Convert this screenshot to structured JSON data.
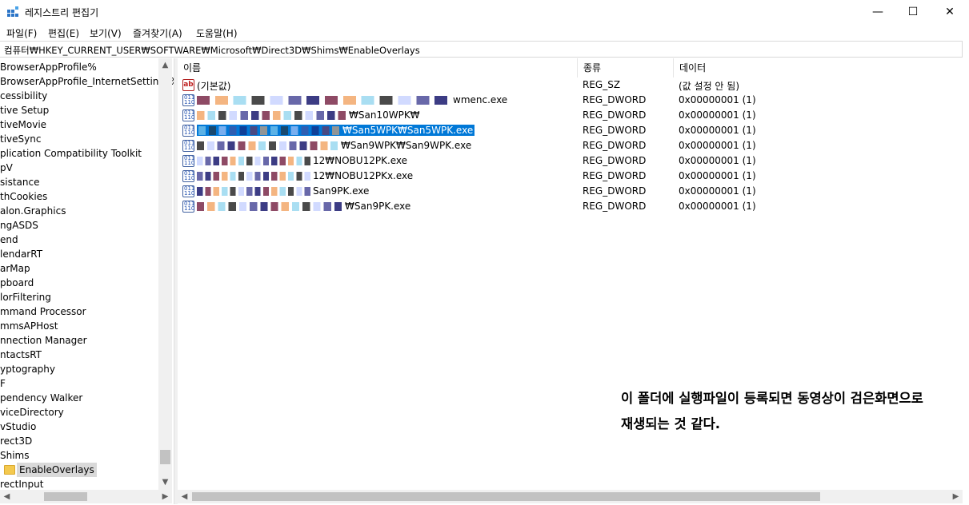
{
  "window": {
    "title": "레지스트리 편집기",
    "minimize_glyph": "—",
    "maximize_glyph": "☐",
    "close_glyph": "✕"
  },
  "menu": [
    "파일(F)",
    "편집(E)",
    "보기(V)",
    "즐겨찾기(A)",
    "도움말(H)"
  ],
  "address": "컴퓨터₩HKEY_CURRENT_USER₩SOFTWARE₩Microsoft₩Direct3D₩Shims₩EnableOverlays",
  "tree": {
    "items": [
      "BrowserAppProfile%",
      "BrowserAppProfile_InternetSettings%",
      "cessibility",
      "tive Setup",
      "tiveMovie",
      "tiveSync",
      "plication Compatibility Toolkit",
      "pV",
      "sistance",
      "thCookies",
      "alon.Graphics",
      "ngASDS",
      "end",
      "lendarRT",
      "arMap",
      "pboard",
      "lorFiltering",
      "mmand Processor",
      "mmsAPHost",
      "nnection Manager",
      "ntactsRT",
      "yptography",
      "F",
      "pendency Walker",
      "viceDirectory",
      "vStudio",
      "rect3D",
      "Shims",
      "EnableOverlays",
      "rectInput"
    ],
    "selected_index": 28
  },
  "columns": [
    "이름",
    "종류",
    "데이터"
  ],
  "rows": [
    {
      "icon": "string-value-icon",
      "name": "(기본값)",
      "type": "REG_SZ",
      "data": "(값 설정 안 됨)"
    },
    {
      "icon": "dword-value-icon",
      "name": "wmenc.exe",
      "type": "REG_DWORD",
      "data": "0x00000001 (1)"
    },
    {
      "icon": "dword-value-icon",
      "name": "₩San10WPK₩",
      "type": "REG_DWORD",
      "data": "0x00000001 (1)"
    },
    {
      "icon": "dword-value-icon",
      "name": "₩San5WPK₩San5WPK.exe",
      "type": "REG_DWORD",
      "data": "0x00000001 (1)"
    },
    {
      "icon": "dword-value-icon",
      "name": "₩San9WPK₩San9WPK.exe",
      "type": "REG_DWORD",
      "data": "0x00000001 (1)"
    },
    {
      "icon": "dword-value-icon",
      "name": "12₩NOBU12PK.exe",
      "type": "REG_DWORD",
      "data": "0x00000001 (1)"
    },
    {
      "icon": "dword-value-icon",
      "name": "12₩NOBU12PKx.exe",
      "type": "REG_DWORD",
      "data": "0x00000001 (1)"
    },
    {
      "icon": "dword-value-icon",
      "name": "San9PK.exe",
      "type": "REG_DWORD",
      "data": "0x00000001 (1)"
    },
    {
      "icon": "dword-value-icon",
      "name": "₩San9PK.exe",
      "type": "REG_DWORD",
      "data": "0x00000001 (1)"
    }
  ],
  "selected_row": 3,
  "note": {
    "line1": "이 폴더에 실행파일이 등록되면 동영상이 검은화면으로",
    "line2": "재생되는 것 같다."
  },
  "icons": {
    "string": "ab",
    "dword": "011\n110"
  },
  "colors": {
    "selection": "#0078d7",
    "tree_selection": "#d9d9d9",
    "folder": "#f4c94e"
  }
}
